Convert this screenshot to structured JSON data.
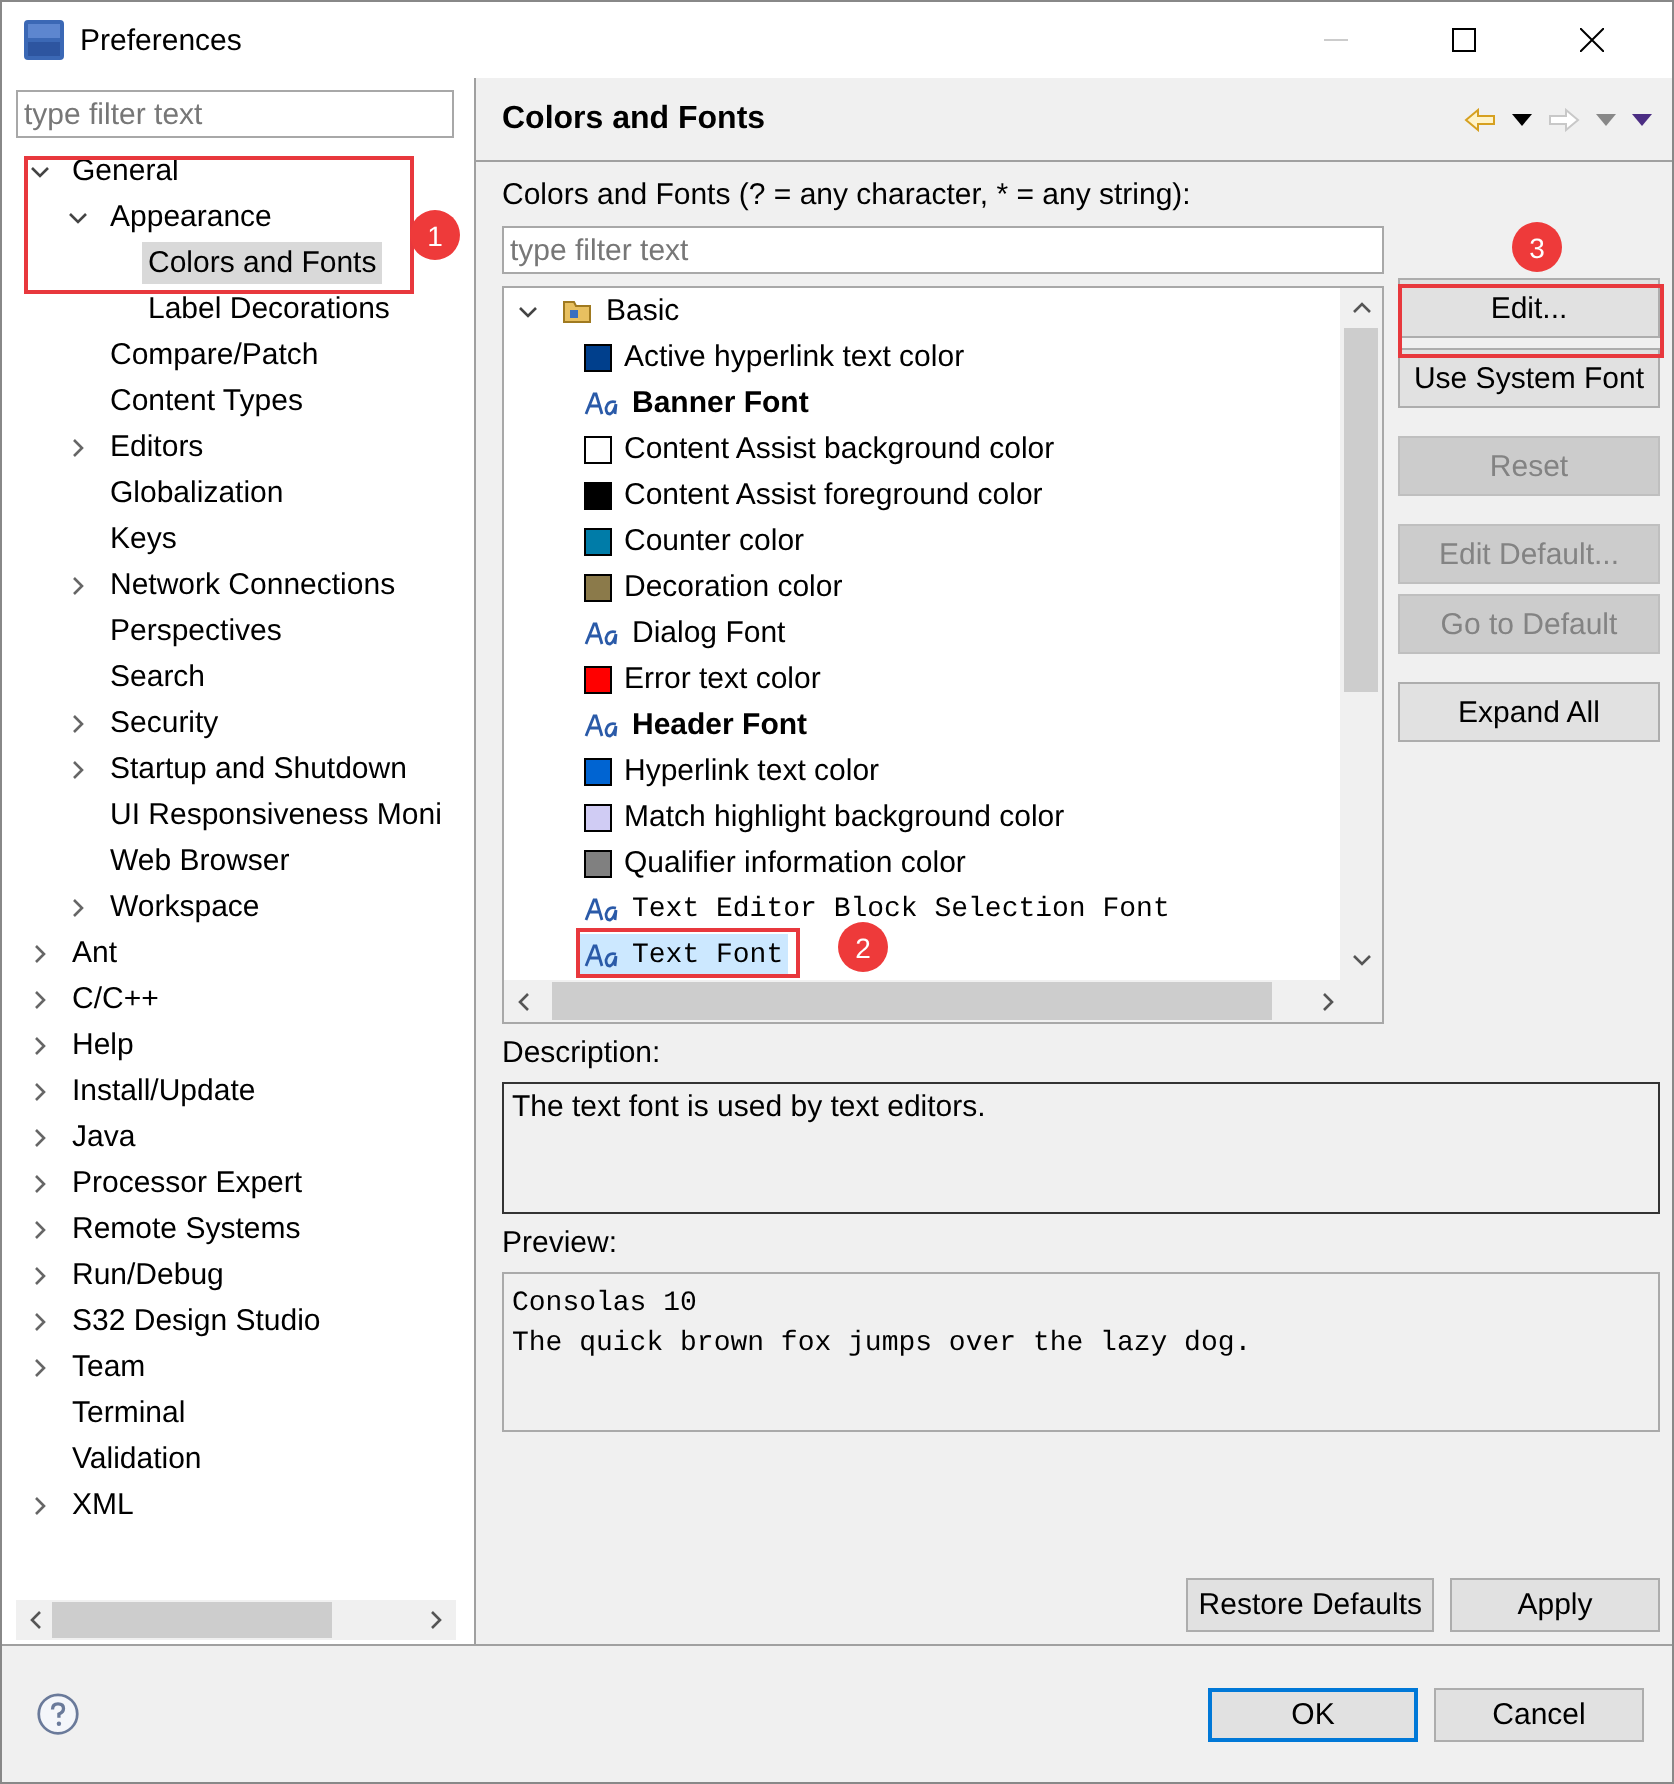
{
  "window": {
    "title": "Preferences"
  },
  "sidebar": {
    "filter": {
      "placeholder": "type filter text"
    },
    "tree": [
      {
        "label": "General",
        "expanded": true,
        "selected": false,
        "children": [
          {
            "label": "Appearance",
            "expanded": true,
            "selected": false,
            "children": [
              {
                "label": "Colors and Fonts",
                "selected": true
              },
              {
                "label": "Label Decorations",
                "selected": false
              }
            ]
          },
          {
            "label": "Compare/Patch",
            "selected": false
          },
          {
            "label": "Content Types",
            "selected": false
          },
          {
            "label": "Editors",
            "expanded": false,
            "selected": false
          },
          {
            "label": "Globalization",
            "selected": false
          },
          {
            "label": "Keys",
            "selected": false
          },
          {
            "label": "Network Connections",
            "expanded": false,
            "selected": false
          },
          {
            "label": "Perspectives",
            "selected": false
          },
          {
            "label": "Search",
            "selected": false
          },
          {
            "label": "Security",
            "expanded": false,
            "selected": false
          },
          {
            "label": "Startup and Shutdown",
            "expanded": false,
            "selected": false
          },
          {
            "label": "UI Responsiveness Moni",
            "selected": false
          },
          {
            "label": "Web Browser",
            "selected": false
          },
          {
            "label": "Workspace",
            "expanded": false,
            "selected": false
          }
        ]
      },
      {
        "label": "Ant",
        "expanded": false,
        "selected": false
      },
      {
        "label": "C/C++",
        "expanded": false,
        "selected": false
      },
      {
        "label": "Help",
        "expanded": false,
        "selected": false
      },
      {
        "label": "Install/Update",
        "expanded": false,
        "selected": false
      },
      {
        "label": "Java",
        "expanded": false,
        "selected": false
      },
      {
        "label": "Processor Expert",
        "expanded": false,
        "selected": false
      },
      {
        "label": "Remote Systems",
        "expanded": false,
        "selected": false
      },
      {
        "label": "Run/Debug",
        "expanded": false,
        "selected": false
      },
      {
        "label": "S32 Design Studio",
        "expanded": false,
        "selected": false
      },
      {
        "label": "Team",
        "expanded": false,
        "selected": false
      },
      {
        "label": "Terminal",
        "selected": false
      },
      {
        "label": "Validation",
        "selected": false
      },
      {
        "label": "XML",
        "expanded": false,
        "selected": false
      }
    ]
  },
  "page": {
    "title": "Colors and Fonts",
    "filter_label": "Colors and Fonts (? = any character, * = any string):",
    "filter": {
      "placeholder": "type filter text"
    },
    "group": {
      "label": "Basic",
      "expanded": true
    },
    "items": [
      {
        "kind": "color",
        "label": "Active hyperlink text color",
        "color": "#003f8c",
        "selected": false
      },
      {
        "kind": "bold-font",
        "label": "Banner Font",
        "selected": false
      },
      {
        "kind": "color",
        "label": "Content Assist background color",
        "color": "#ffffff",
        "selected": false
      },
      {
        "kind": "color",
        "label": "Content Assist foreground color",
        "color": "#000000",
        "selected": false
      },
      {
        "kind": "color",
        "label": "Counter color",
        "color": "#007ca8",
        "selected": false
      },
      {
        "kind": "color",
        "label": "Decoration color",
        "color": "#8b7a4a",
        "selected": false
      },
      {
        "kind": "font",
        "label": "Dialog Font",
        "selected": false
      },
      {
        "kind": "color",
        "label": "Error text color",
        "color": "#ff0000",
        "selected": false
      },
      {
        "kind": "bold-font",
        "label": "Header Font",
        "selected": false
      },
      {
        "kind": "color",
        "label": "Hyperlink text color",
        "color": "#0064d2",
        "selected": false
      },
      {
        "kind": "color",
        "label": "Match highlight background color",
        "color": "#d0ccf4",
        "selected": false
      },
      {
        "kind": "color",
        "label": "Qualifier information color",
        "color": "#808080",
        "selected": false
      },
      {
        "kind": "mono-font",
        "label": "Text Editor Block Selection Font",
        "selected": false
      },
      {
        "kind": "mono-font",
        "label": "Text Font",
        "selected": true
      }
    ],
    "buttons": [
      {
        "label": "Edit...",
        "disabled": false
      },
      {
        "label": "Use System Font",
        "disabled": false
      },
      {
        "label": "Reset",
        "disabled": true
      },
      {
        "label": "Edit Default...",
        "disabled": true
      },
      {
        "label": "Go to Default",
        "disabled": true
      },
      {
        "label": "Expand All",
        "disabled": false
      }
    ],
    "description_label": "Description:",
    "description": "The text font is used by text editors.",
    "preview_label": "Preview:",
    "preview": [
      "Consolas 10",
      "The quick brown fox jumps over the lazy dog."
    ],
    "actions": [
      "Restore Defaults",
      "Apply"
    ]
  },
  "dialog_buttons": [
    {
      "label": "OK",
      "default": true
    },
    {
      "label": "Cancel",
      "default": false
    }
  ],
  "callouts": [
    {
      "number": "1"
    },
    {
      "number": "2"
    },
    {
      "number": "3"
    }
  ]
}
